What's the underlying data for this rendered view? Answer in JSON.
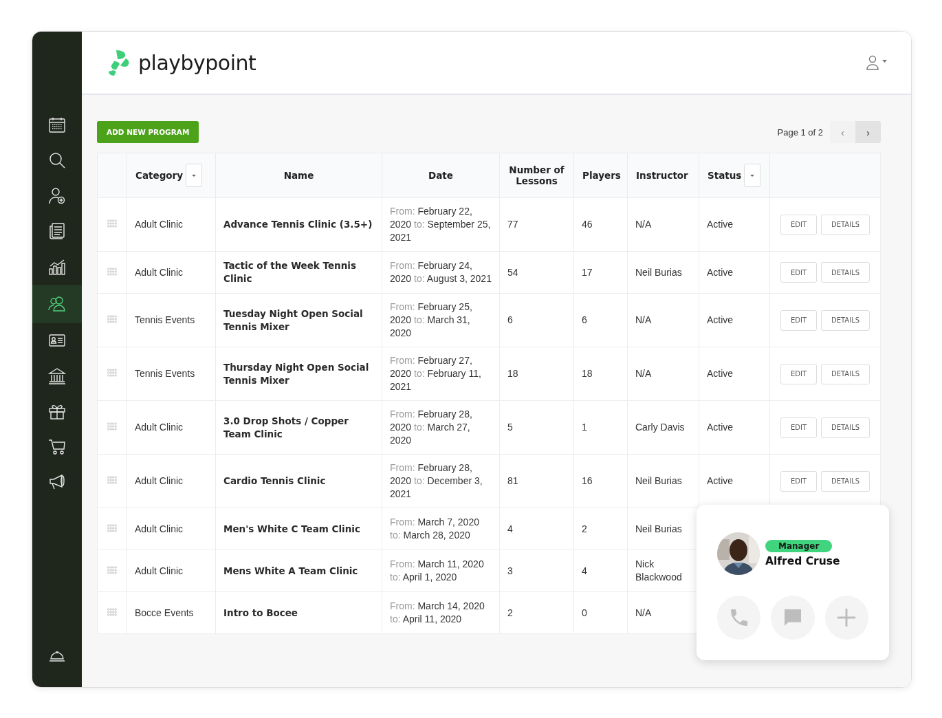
{
  "brand": {
    "name": "playbypoint"
  },
  "sidebar": {
    "items": [
      {
        "selected": false
      },
      {
        "selected": false
      },
      {
        "selected": false
      },
      {
        "selected": false
      },
      {
        "selected": false
      },
      {
        "selected": true
      },
      {
        "selected": false
      },
      {
        "selected": false
      },
      {
        "selected": false
      },
      {
        "selected": false
      },
      {
        "selected": false
      }
    ],
    "footer_item": {
      "selected": false
    }
  },
  "toolbar": {
    "add_button": "ADD NEW PROGRAM",
    "page_label": "Page 1 of 2",
    "prev": "‹",
    "next": "›",
    "prev_disabled": true
  },
  "table": {
    "columns": [
      {
        "label": "Category",
        "kind": "dropdown"
      },
      {
        "label": "Name",
        "kind": "plain"
      },
      {
        "label": "Date",
        "kind": "plain"
      },
      {
        "label": "Number of Lessons",
        "kind": "plain"
      },
      {
        "label": "Players",
        "kind": "plain"
      },
      {
        "label": "Instructor",
        "kind": "plain"
      },
      {
        "label": "Status",
        "kind": "dropdown"
      }
    ],
    "rows": [
      {
        "category": "Adult Clinic",
        "name": "Advance Tennis Clinic (3.5+)",
        "from_label": "From:",
        "from": "February 22, 2020",
        "to_label": "to:",
        "to": "September 25, 2021",
        "lessons": "77",
        "players": "46",
        "instructor": "N/A",
        "status": "Active",
        "edit": "EDIT",
        "details": "DETAILS"
      },
      {
        "category": "Adult Clinic",
        "name": "Tactic of the Week Tennis Clinic",
        "from_label": "From:",
        "from": "February 24, 2020",
        "to_label": "to:",
        "to": "August 3, 2021",
        "lessons": "54",
        "players": "17",
        "instructor": "Neil Burias",
        "status": "Active",
        "edit": "EDIT",
        "details": "DETAILS"
      },
      {
        "category": "Tennis Events",
        "name": "Tuesday Night Open Social Tennis Mixer",
        "from_label": "From:",
        "from": "February 25, 2020",
        "to_label": "to:",
        "to": "March 31, 2020",
        "lessons": "6",
        "players": "6",
        "instructor": "N/A",
        "status": "Active",
        "edit": "EDIT",
        "details": "DETAILS"
      },
      {
        "category": "Tennis Events",
        "name": "Thursday Night Open Social Tennis Mixer",
        "from_label": "From:",
        "from": "February 27, 2020",
        "to_label": "to:",
        "to": "February 11, 2021",
        "lessons": "18",
        "players": "18",
        "instructor": "N/A",
        "status": "Active",
        "edit": "EDIT",
        "details": "DETAILS"
      },
      {
        "category": "Adult Clinic",
        "name": "3.0 Drop Shots / Copper Team Clinic",
        "from_label": "From:",
        "from": "February 28, 2020",
        "to_label": "to:",
        "to": "March 27, 2020",
        "lessons": "5",
        "players": "1",
        "instructor": "Carly Davis",
        "status": "Active",
        "edit": "EDIT",
        "details": "DETAILS"
      },
      {
        "category": "Adult Clinic",
        "name": "Cardio Tennis Clinic",
        "from_label": "From:",
        "from": "February 28, 2020",
        "to_label": "to:",
        "to": "December 3, 2021",
        "lessons": "81",
        "players": "16",
        "instructor": "Neil Burias",
        "status": "Active",
        "edit": "EDIT",
        "details": "DETAILS"
      },
      {
        "category": "Adult Clinic",
        "name": "Men's White C Team Clinic",
        "from_label": "From:",
        "from": "March 7, 2020",
        "to_label": "to:",
        "to": "March 28, 2020",
        "lessons": "4",
        "players": "2",
        "instructor": "Neil Burias"
      },
      {
        "category": "Adult Clinic",
        "name": "Mens White A Team Clinic",
        "from_label": "From:",
        "from": "March 11, 2020",
        "to_label": "to:",
        "to": "April 1, 2020",
        "lessons": "3",
        "players": "4",
        "instructor": "Nick Blackwood"
      },
      {
        "category": "Bocce Events",
        "name": "Intro to Bocee",
        "from_label": "From:",
        "from": "March 14, 2020",
        "to_label": "to:",
        "to": "April 11, 2020",
        "lessons": "2",
        "players": "0",
        "instructor": "N/A"
      }
    ]
  },
  "contact_card": {
    "role": "Manager",
    "name": "Alfred Cruse"
  }
}
